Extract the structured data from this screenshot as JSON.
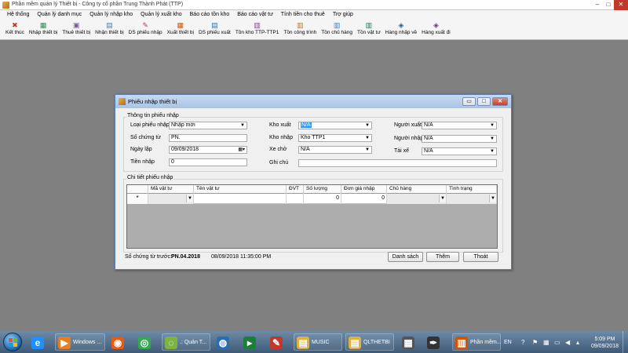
{
  "app": {
    "title": "Phần mềm quản lý Thiết bị - Công ty cổ phần Trung Thành Phát (TTP)",
    "window_buttons": [
      "–",
      "□",
      "✕"
    ]
  },
  "menu": [
    "Hệ thống",
    "Quản lý danh mục",
    "Quản lý nhập kho",
    "Quản lý xuất kho",
    "Báo cáo tồn kho",
    "Báo cáo vật tư",
    "Tính tiền cho thuê",
    "Trợ giúp"
  ],
  "toolbar": [
    {
      "label": "Kết thúc",
      "icon": "exit-icon",
      "glyph": "✖",
      "color": "#c0392b"
    },
    {
      "label": "Nhập thiết bị",
      "icon": "import-device-icon",
      "glyph": "▦",
      "color": "#2e8b57"
    },
    {
      "label": "Thuê thiết bị",
      "icon": "rent-device-icon",
      "glyph": "▣",
      "color": "#7a5c9b"
    },
    {
      "label": "Nhận thiết bị",
      "icon": "receive-device-icon",
      "glyph": "▤",
      "color": "#5c7a9b"
    },
    {
      "label": "DS phiếu nhập",
      "icon": "import-list-icon",
      "glyph": "✎",
      "color": "#b03a5b"
    },
    {
      "label": "Xuất thiết bị",
      "icon": "export-device-icon",
      "glyph": "▦",
      "color": "#d35400"
    },
    {
      "label": "DS phiếu xuất",
      "icon": "export-list-icon",
      "glyph": "▤",
      "color": "#2874a6"
    },
    {
      "label": "Tồn kho TTP-TTP1",
      "icon": "stock-ttp-icon",
      "glyph": "▥",
      "color": "#7d3c98"
    },
    {
      "label": "Tồn công trình",
      "icon": "stock-site-icon",
      "glyph": "▥",
      "color": "#b9770e"
    },
    {
      "label": "Tồn chủ hàng",
      "icon": "stock-owner-icon",
      "glyph": "▥",
      "color": "#2e86c1"
    },
    {
      "label": "Tồn vật tư",
      "icon": "stock-material-icon",
      "glyph": "▥",
      "color": "#117a65"
    },
    {
      "label": "Hàng nhập về",
      "icon": "incoming-goods-icon",
      "glyph": "◈",
      "color": "#1f618d"
    },
    {
      "label": "Hàng xuất đi",
      "icon": "outgoing-goods-icon",
      "glyph": "◈",
      "color": "#6c3483"
    }
  ],
  "dialog": {
    "title": "Phiếu nhập thiết bị",
    "buttons": [
      "▭",
      "□",
      "✕"
    ],
    "info_group": "Thông tin phiếu nhập",
    "fields": {
      "loai_phieu_label": "Loại phiếu nhập",
      "loai_phieu_value": "Nhập mới",
      "so_chung_tu_label": "Số chứng từ",
      "so_chung_tu_value": "PN.",
      "ngay_lap_label": "Ngày lập",
      "ngay_lap_value": "09/09/2018",
      "tien_nhap_label": "Tiền nhập",
      "tien_nhap_value": "0",
      "kho_xuat_label": "Kho xuất",
      "kho_xuat_value": "N/A",
      "kho_nhap_label": "Kho nhập",
      "kho_nhap_value": "Kho TTP1",
      "xe_cho_label": "Xe chở",
      "xe_cho_value": "N/A",
      "ghi_chu_label": "Ghi chú",
      "ghi_chu_value": "",
      "nguoi_xuat_label": "Người xuất",
      "nguoi_xuat_value": "N/A",
      "nguoi_nhap_label": "Người nhập",
      "nguoi_nhap_value": "N/A",
      "tai_xe_label": "Tài xế",
      "tai_xe_value": "N/A"
    },
    "detail_group": "Chi tiết phiếu nhập",
    "grid": {
      "columns": [
        "Mã vật tư",
        "Tên vật tư",
        "ĐVT",
        "Số lượng",
        "Đơn giá nhập",
        "Chủ hàng",
        "Tình trạng"
      ],
      "new_row_marker": "*",
      "new_row": {
        "so_luong": "0",
        "don_gia": "0"
      }
    },
    "footer": {
      "prev_label": "Số chứng từ trước:",
      "prev_value": "PN.04.2018",
      "prev_time": "08/09/2018 11:35:00 PM",
      "btn_list": "Danh sách",
      "btn_add": "Thêm",
      "btn_exit": "Thoát"
    }
  },
  "taskbar": {
    "items": [
      {
        "label": "",
        "icon": "ie-icon"
      },
      {
        "label": "Windows ...",
        "icon": "media-player-icon"
      },
      {
        "label": "",
        "icon": "firefox-icon"
      },
      {
        "label": "",
        "icon": "chrome-icon"
      },
      {
        "label": ".: Quản T...",
        "icon": "app-icon"
      },
      {
        "label": "",
        "icon": "globe-icon"
      },
      {
        "label": "",
        "icon": "media-icon"
      },
      {
        "label": "",
        "icon": "paint-icon"
      },
      {
        "label": "MUSIC",
        "icon": "folder-icon"
      },
      {
        "label": "QLTHETBI",
        "icon": "folder-icon"
      },
      {
        "label": "",
        "icon": "calculator-icon"
      },
      {
        "label": "",
        "icon": "pen-icon"
      },
      {
        "label": "",
        "icon": "chess-icon"
      },
      {
        "label": "Phần mềm...",
        "icon": "app-icon"
      }
    ],
    "lang": "EN",
    "time": "5:09 PM",
    "date": "09/09/2018"
  }
}
